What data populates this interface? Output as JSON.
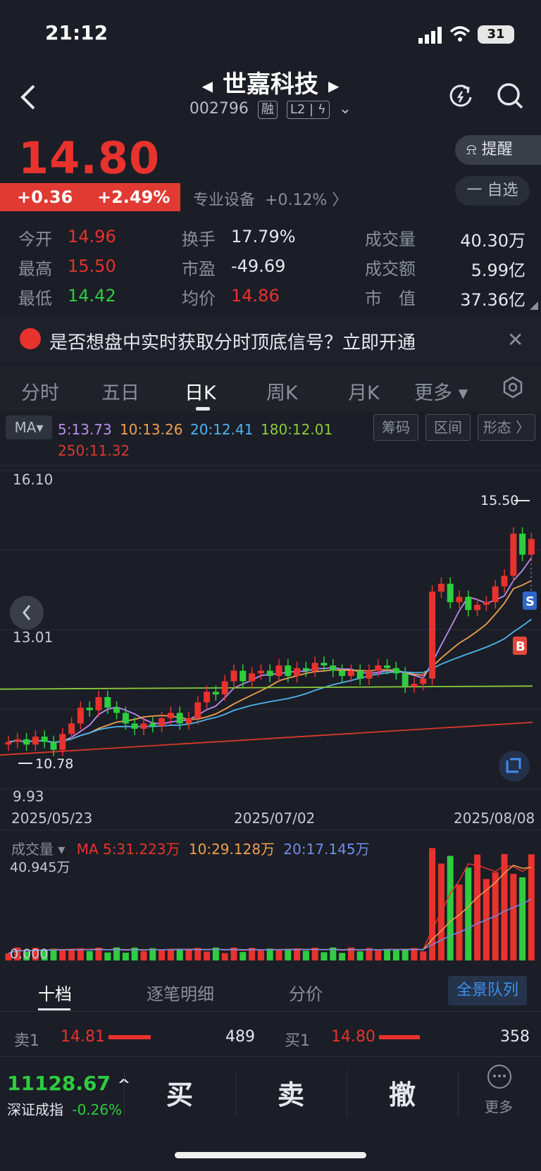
{
  "status_bar": {
    "time": "21:12",
    "battery": "31"
  },
  "header": {
    "title": "世嘉科技",
    "code": "002796",
    "tags": [
      "融",
      "L2"
    ]
  },
  "quote": {
    "price": "14.80",
    "change": "+0.36",
    "change_pct": "+2.49%",
    "sector_name": "专业设备",
    "sector_change": "+0.12%",
    "alert_label": "提醒",
    "watch_label": "一 自选"
  },
  "stats": {
    "open_label": "今开",
    "open": "14.96",
    "high_label": "最高",
    "high": "15.50",
    "low_label": "最低",
    "low": "14.42",
    "turnover_label": "换手",
    "turnover": "17.79%",
    "pe_label": "市盈",
    "pe": "-49.69",
    "avg_label": "均价",
    "avg": "14.86",
    "volume_label": "成交量",
    "volume": "40.30万",
    "amount_label": "成交额",
    "amount": "5.99亿",
    "mktcap_label": "市　值",
    "mktcap": "37.36亿"
  },
  "banner": {
    "text": "是否想盘中实时获取分时顶底信号？立即开通",
    "close": "✕"
  },
  "chart_tabs": [
    {
      "label": "分时"
    },
    {
      "label": "五日"
    },
    {
      "label": "日K"
    },
    {
      "label": "周K"
    },
    {
      "label": "月K"
    },
    {
      "label": "更多 ▾"
    }
  ],
  "ma": {
    "selector": "MA▾",
    "ma5": "5:13.73",
    "ma10": "10:13.26",
    "ma20": "20:12.41",
    "ma180": "180:12.01",
    "ma250": "250:11.32",
    "colors": {
      "ma5": "#b98cf0",
      "ma10": "#f0a050",
      "ma20": "#4fb3f0",
      "ma180": "#8ccc3c",
      "ma250": "#d83a2a"
    }
  },
  "tools": {
    "chip": "筹码",
    "range": "区间",
    "shape": "形态 〉"
  },
  "chart_data": {
    "type": "candlestick",
    "y_top_label": "16.10",
    "y_mid_label": "13.01",
    "y_bottom_label": "9.93",
    "high_marker": "15.50",
    "low_marker": "10.78",
    "ylim": [
      9.93,
      16.1
    ],
    "x_labels": [
      "2025/05/23",
      "2025/07/02",
      "2025/08/08"
    ],
    "buy_marker": "B",
    "sell_marker": "S",
    "closes": [
      10.95,
      11.0,
      10.9,
      11.05,
      10.95,
      10.8,
      11.1,
      11.3,
      11.6,
      11.55,
      11.8,
      11.6,
      11.5,
      11.3,
      11.2,
      11.3,
      11.25,
      11.4,
      11.5,
      11.3,
      11.4,
      11.7,
      11.9,
      11.85,
      12.1,
      12.3,
      12.1,
      12.25,
      12.3,
      12.2,
      12.4,
      12.2,
      12.35,
      12.3,
      12.45,
      12.4,
      12.3,
      12.2,
      12.3,
      12.15,
      12.3,
      12.4,
      12.35,
      12.25,
      12.0,
      12.05,
      12.15,
      13.8,
      13.95,
      13.6,
      13.7,
      13.45,
      13.55,
      13.6,
      13.9,
      14.1,
      14.9,
      14.5,
      14.8
    ],
    "volume": {
      "label": "成交量",
      "ma5": "MA 5:31.223万",
      "ma10": "10:29.128万",
      "ma20": "20:17.145万",
      "max_label": "40.945万",
      "zero_label": "0.000"
    }
  },
  "depth_tabs": {
    "ten": "十档",
    "tick": "逐笔明细",
    "price": "分价",
    "queue": "全景队列"
  },
  "depth": {
    "ask_label": "卖1",
    "ask_price": "14.81",
    "ask_vol": "489",
    "bid_label": "买1",
    "bid_price": "14.80",
    "bid_vol": "358"
  },
  "bottom": {
    "index_value": "11128.67",
    "index_arrow": "^",
    "index_name": "深证成指",
    "index_change": "-0.26%",
    "buy": "买",
    "sell": "卖",
    "cancel": "撤",
    "more": "更多"
  }
}
